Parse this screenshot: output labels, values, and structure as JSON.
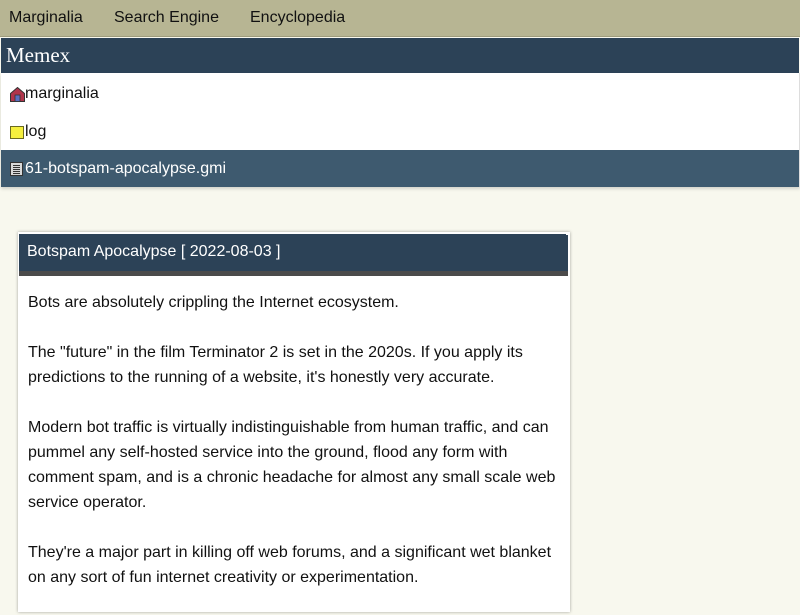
{
  "topnav": {
    "items": [
      {
        "label": "Marginalia"
      },
      {
        "label": "Search Engine"
      },
      {
        "label": "Encyclopedia"
      }
    ]
  },
  "memex": {
    "title": "Memex"
  },
  "breadcrumbs": [
    {
      "label": "marginalia",
      "icon": "house-icon"
    },
    {
      "label": "log",
      "icon": "folder-icon"
    },
    {
      "label": "61-botspam-apocalypse.gmi",
      "icon": "file-icon"
    }
  ],
  "article": {
    "header": "Botspam Apocalypse [ 2022-08-03 ]",
    "paragraphs": [
      "Bots are absolutely crippling the Internet ecosystem.",
      "The \"future\" in the film Terminator 2 is set in the 2020s. If you apply its predictions to the running of a website, it's honestly very accurate.",
      "Modern bot traffic is virtually indistinguishable from human traffic, and can pummel any self-hosted service into the ground, flood any form with comment spam, and is a chronic headache for almost any small scale web service operator.",
      "They're a major part in killing off web forums, and a significant wet blanket on any sort of fun internet creativity or experimentation."
    ]
  },
  "colors": {
    "nav_bg": "#b7b593",
    "header_bg": "#2c4257",
    "selected_crumb_bg": "#3e5a6f",
    "page_bg": "#f8f8ee"
  }
}
